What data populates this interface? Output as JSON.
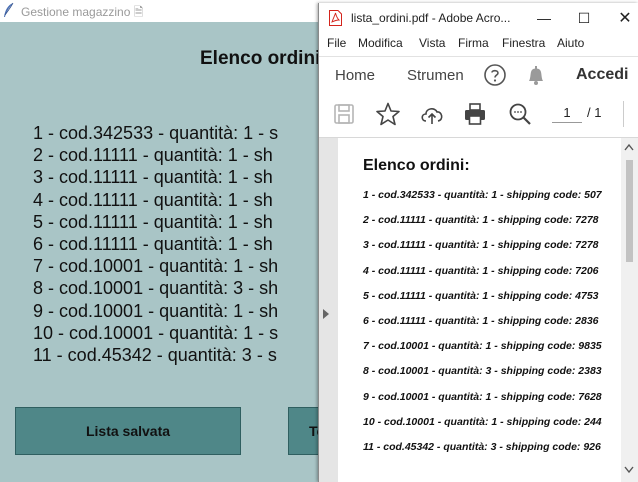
{
  "background_app": {
    "title": "Gestione magazzino 🗎",
    "heading": "Elenco ordini",
    "orders": [
      "1  -  cod.342533  -  quantità: 1  -  s",
      "2  -  cod.11111  -  quantità: 1  -  sh",
      "3  -  cod.11111  -  quantità: 1  -  sh",
      "4  -  cod.11111  -  quantità: 1  -  sh",
      "5  -  cod.11111  -  quantità: 1  -  sh",
      "6  -  cod.11111  -  quantità: 1  -  sh",
      "7  -  cod.10001  -  quantità: 1  -  sh",
      "8  -  cod.10001  -  quantità: 3  -  sh",
      "9  -  cod.10001  -  quantità: 1  -  sh",
      "10  -  cod.10001  -  quantità: 1  -  s",
      "11  -  cod.45342  -  quantità: 3  -  s"
    ],
    "buttons": {
      "saved_list": "Lista salvata",
      "second": "To"
    }
  },
  "acrobat": {
    "window_title": "lista_ordini.pdf - Adobe Acro...",
    "controls": {
      "minimize": "—",
      "maximize": "☐",
      "close": "✕"
    },
    "menu": [
      "File",
      "Modifica",
      "Vista",
      "Firma",
      "Finestra",
      "Aiuto"
    ],
    "tabs": {
      "home": "Home",
      "tools": "Strumen"
    },
    "sign_in": "Accedi",
    "page": {
      "current": "1",
      "total": "/ 1"
    },
    "document": {
      "heading": "Elenco ordini:",
      "lines": [
        "1 - cod.342533 - quantità: 1 - shipping code: 507",
        "2 - cod.11111 - quantità: 1 - shipping code: 7278",
        "3 - cod.11111 - quantità: 1 - shipping code: 7278",
        "4 - cod.11111 - quantità: 1 - shipping code: 7206",
        "5 - cod.11111 - quantità: 1 - shipping code: 4753",
        "6 - cod.11111 - quantità: 1 - shipping code: 2836",
        "7 - cod.10001 - quantità: 1 - shipping code: 9835",
        "8 - cod.10001 - quantità: 3 - shipping code: 2383",
        "9 - cod.10001 - quantità: 1 - shipping code: 7628",
        "10 - cod.10001 - quantità: 1 - shipping code: 244",
        "11 - cod.45342 - quantità: 3 - shipping code: 926"
      ]
    }
  },
  "colors": {
    "app_background": "#a9c5c6",
    "app_button": "#4f8788",
    "pdf_icon_red": "#d4241c"
  }
}
